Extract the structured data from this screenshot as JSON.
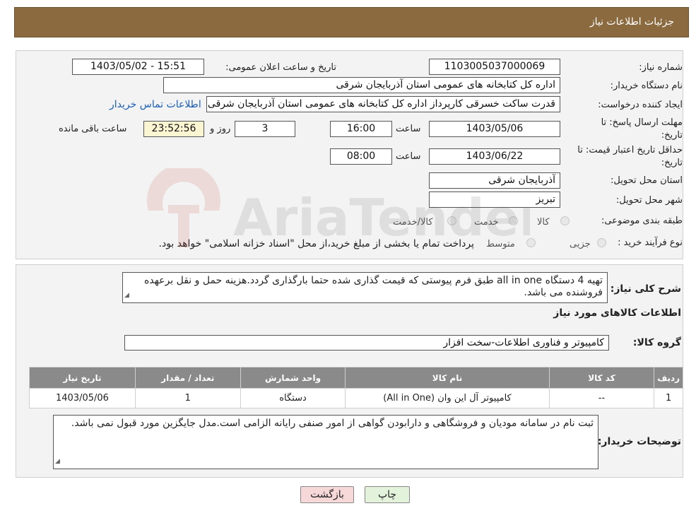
{
  "header": {
    "title": "جزئیات اطلاعات نیاز"
  },
  "form": {
    "need_number_label": "شماره نیاز:",
    "need_number": "1103005037000069",
    "announce_label": "تاریخ و ساعت اعلان عمومی:",
    "announce_value": "1403/05/02 - 15:51",
    "buyer_org_label": "نام دستگاه خریدار:",
    "buyer_org": "اداره کل کتابخانه های عمومی استان آذربایجان شرقی",
    "creator_label": "ایجاد کننده درخواست:",
    "creator": "قدرت ساکت خسرقی کارپرداز اداره کل کتابخانه های عمومی استان آذربایجان شرقی",
    "contact_link": "اطلاعات تماس خریدار",
    "deadline_label": "مهلت ارسال پاسخ: تا تاریخ:",
    "deadline_date": "1403/05/06",
    "time_label": "ساعت",
    "deadline_time": "16:00",
    "days_value": "3",
    "days_label": "روز و",
    "remaining_time": "23:52:56",
    "remaining_label": "ساعت باقی مانده",
    "validity_label": "حداقل تاریخ اعتبار قیمت: تا تاریخ:",
    "validity_date": "1403/06/22",
    "validity_time": "08:00",
    "province_label": "استان محل تحویل:",
    "province": "آذربایجان شرقی",
    "city_label": "شهر محل تحویل:",
    "city": "تبریز",
    "category_label": "طبقه بندی موضوعی:",
    "category_options": [
      "کالا",
      "خدمت",
      "کالا/خدمت"
    ],
    "process_label": "نوع فرآیند خرید :",
    "process_options": [
      "جزیی",
      "متوسط"
    ],
    "process_note": "پرداخت تمام یا بخشی از مبلغ خرید،از محل \"اسناد خزانه اسلامی\" خواهد بود."
  },
  "details": {
    "description_label": "شرح کلی نیاز:",
    "description": "تهیه 4 دستگاه all in one طبق فرم پیوستی که قیمت گذاری شده حتما بارگذاری گردد.هزینه حمل و نقل برعهده فروشنده می باشد.",
    "goods_info_title": "اطلاعات کالاهای مورد نیاز",
    "goods_group_label": "گروه کالا:",
    "goods_group": "کامپیوتر و فناوری اطلاعات-سخت افزار",
    "table": {
      "headers": [
        "ردیف",
        "کد کالا",
        "نام کالا",
        "واحد شمارش",
        "تعداد / مقدار",
        "تاریخ نیاز"
      ],
      "rows": [
        [
          "1",
          "--",
          "کامپیوتر آل این وان (All in One)",
          "دستگاه",
          "1",
          "1403/05/06"
        ]
      ]
    },
    "buyer_notes_label": "توضیحات خریدار:",
    "buyer_notes": "ثبت نام در سامانه مودیان و فروشگاهی و دارابودن گواهی از امور صنفی رایانه الزامی است.مدل جایگزین مورد قبول نمی باشد."
  },
  "buttons": {
    "print": "چاپ",
    "back": "بازگشت"
  },
  "watermark_text": "AriaTender.neT",
  "colors": {
    "header": "#8b6a3f",
    "table_header": "#8a8a8a",
    "back_button": "#f6d8d8",
    "print_button": "#e3f2da"
  }
}
